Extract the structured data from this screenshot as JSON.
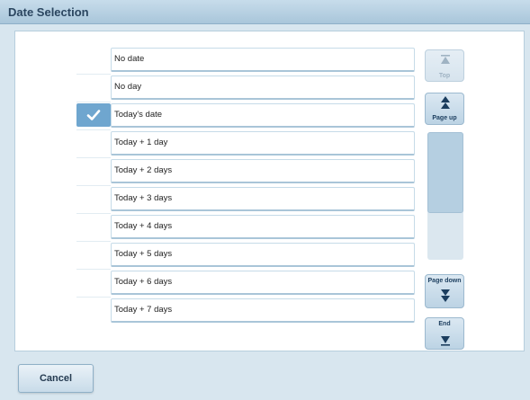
{
  "window": {
    "title": "Date Selection"
  },
  "date_list": {
    "items": [
      {
        "label": "No date",
        "selected": false
      },
      {
        "label": "No day",
        "selected": false
      },
      {
        "label": "Today's date",
        "selected": true
      },
      {
        "label": "Today + 1 day",
        "selected": false
      },
      {
        "label": "Today + 2 days",
        "selected": false
      },
      {
        "label": "Today + 3 days",
        "selected": false
      },
      {
        "label": "Today + 4 days",
        "selected": false
      },
      {
        "label": "Today + 5 days",
        "selected": false
      },
      {
        "label": "Today + 6 days",
        "selected": false
      },
      {
        "label": "Today + 7 days",
        "selected": false
      }
    ]
  },
  "scroll": {
    "top_label": "Top",
    "page_up_label": "Page up",
    "page_down_label": "Page down",
    "end_label": "End",
    "top_enabled": false
  },
  "footer": {
    "cancel_label": "Cancel"
  },
  "colors": {
    "accent": "#6fa6cf",
    "title_text": "#2b4660",
    "background": "#d8e6ef"
  }
}
